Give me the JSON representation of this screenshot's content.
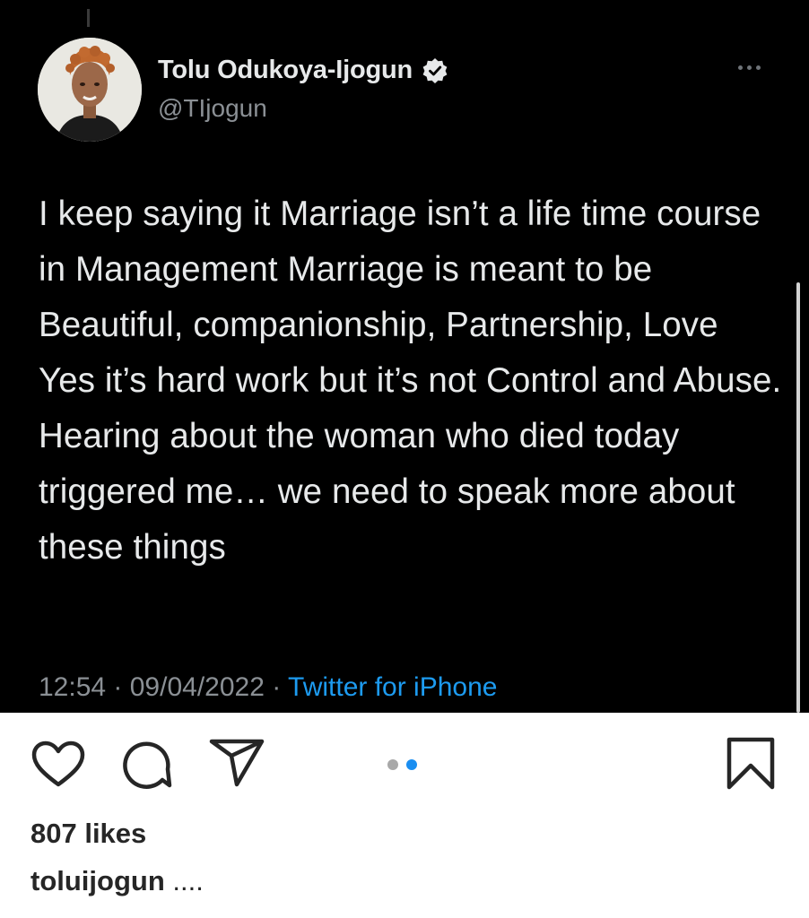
{
  "tweet": {
    "author_name": "Tolu Odukoya-Ijogun",
    "author_handle": "@TIjogun",
    "verified_icon": "verified-badge-icon",
    "more_icon": "more-options-icon",
    "text": "I keep saying it Marriage isn’t a life time course in Management Marriage is meant to be Beautiful, companionship, Partnership, Love Yes it’s hard work but it’s not Control and Abuse. Hearing about the woman who died today triggered me… we need to speak more about these things",
    "time": "12:54",
    "date": "09/04/2022",
    "source": "Twitter for iPhone",
    "separator": " · ",
    "colors": {
      "background": "#000000",
      "text": "#e7e9ea",
      "muted": "#8b9095",
      "link": "#1d9bf0"
    }
  },
  "post": {
    "icons": [
      "heart-icon",
      "comment-icon",
      "share-icon",
      "bookmark-icon"
    ],
    "carousel": {
      "count": 2,
      "active_index": 1,
      "active_color": "#1a8ef1"
    },
    "likes": "807 likes",
    "caption_user": "toluijogun",
    "caption_text": "...."
  }
}
